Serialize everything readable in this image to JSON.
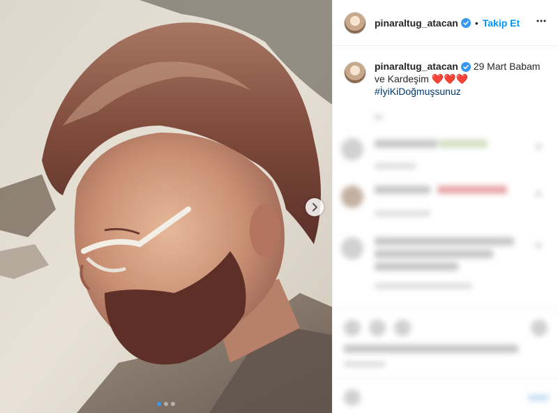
{
  "header": {
    "username": "pinaraltug_atacan",
    "separator": "•",
    "follow_label": "Takip Et"
  },
  "caption": {
    "username": "pinaraltug_atacan",
    "text": " 29 Mart Babam ve Kardeşim ",
    "hearts": "❤️❤️❤️",
    "hashtag": "#İyiKiDoğmuşsunuz"
  },
  "colors": {
    "follow": "#0095f6",
    "verified": "#3897f0",
    "hashtag": "#00376b"
  },
  "icons": {
    "verified": "verified-badge-icon",
    "next": "chevron-right-icon",
    "more": "more-options-icon"
  }
}
